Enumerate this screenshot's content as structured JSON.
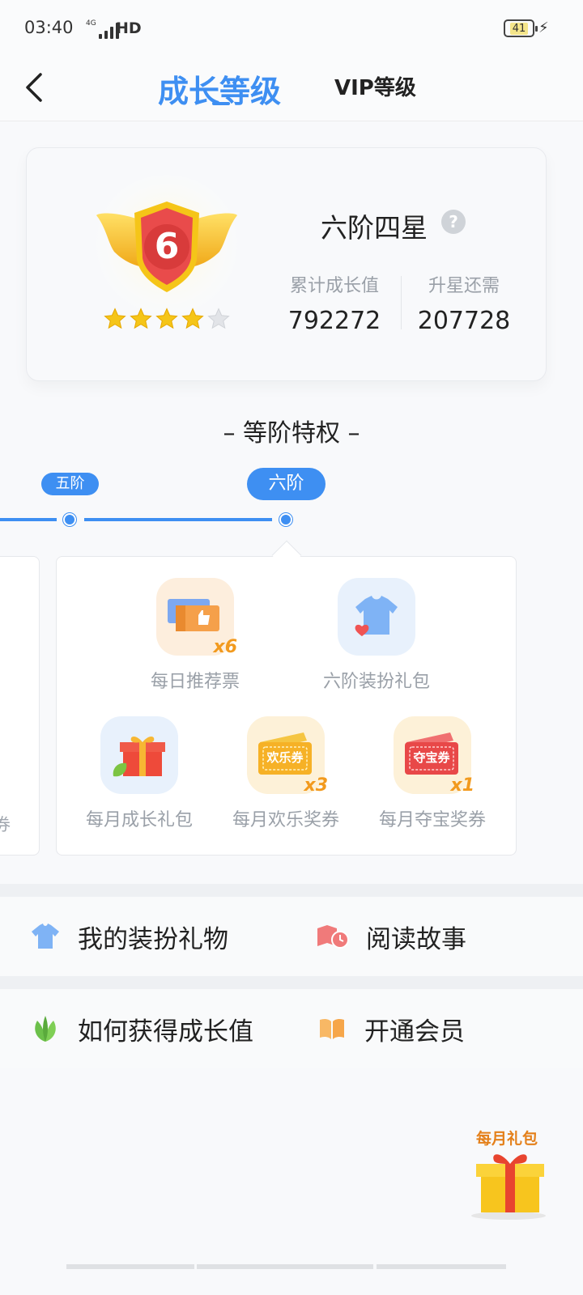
{
  "status_bar": {
    "time": "03:40",
    "network": "4G",
    "hd": "HD",
    "battery": "41"
  },
  "header": {
    "tab_active": "成长等级",
    "tab_other": "VIP等级"
  },
  "level_card": {
    "level_name": "六阶四星",
    "help": "?",
    "stars_filled": 4,
    "stars_total": 5,
    "badge_number": "6",
    "stats": [
      {
        "label": "累计成长值",
        "value": "792272"
      },
      {
        "label": "升星还需",
        "value": "207728"
      }
    ]
  },
  "privileges": {
    "title": "– 等阶特权 –",
    "stages": [
      "五阶",
      "六阶"
    ],
    "prev_card_tail": "券",
    "perks": [
      {
        "label": "每日推荐票",
        "multiplier": "x6",
        "icon": "ticket-icon"
      },
      {
        "label": "六阶装扮礼包",
        "multiplier": "",
        "icon": "shirt-heart-icon"
      },
      {
        "label": "每月成长礼包",
        "multiplier": "",
        "icon": "gift-box-icon"
      },
      {
        "label": "每月欢乐奖券",
        "multiplier": "x3",
        "icon": "joy-coupon-icon",
        "coupon_text": "欢乐券"
      },
      {
        "label": "每月夺宝奖券",
        "multiplier": "x1",
        "icon": "treasure-coupon-icon",
        "coupon_text": "夺宝券"
      }
    ]
  },
  "menu": [
    {
      "label": "我的装扮礼物",
      "icon": "shirt-icon"
    },
    {
      "label": "阅读故事",
      "icon": "story-icon"
    },
    {
      "label": "如何获得成长值",
      "icon": "leaf-icon"
    },
    {
      "label": "开通会员",
      "icon": "book-icon"
    }
  ],
  "floating_gift": {
    "label": "每月礼包"
  },
  "colors": {
    "accent": "#3e8ff2",
    "orange": "#f29a1e",
    "red": "#e94b4b",
    "gold": "#f5c518"
  }
}
